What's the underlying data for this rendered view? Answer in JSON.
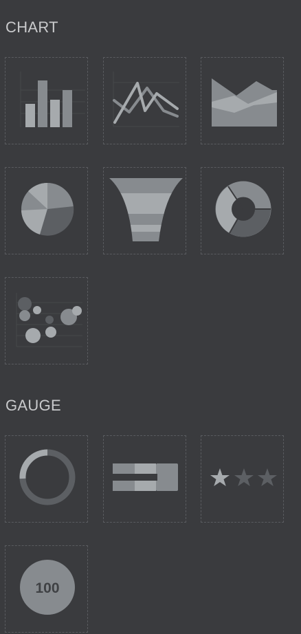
{
  "sections": {
    "chart": {
      "title": "CHART",
      "items": [
        {
          "icon": "bar-chart-icon"
        },
        {
          "icon": "line-chart-icon"
        },
        {
          "icon": "area-chart-icon"
        },
        {
          "icon": "pie-chart-icon"
        },
        {
          "icon": "funnel-chart-icon"
        },
        {
          "icon": "donut-chart-icon"
        },
        {
          "icon": "scatter-chart-icon"
        }
      ]
    },
    "gauge": {
      "title": "GAUGE",
      "items": [
        {
          "icon": "ring-gauge-icon"
        },
        {
          "icon": "bullet-gauge-icon"
        },
        {
          "icon": "star-rating-icon"
        },
        {
          "icon": "kpi-number-icon",
          "label": "100"
        }
      ]
    }
  },
  "colors": {
    "background": "#3a3b3e",
    "light": "#a6aaad",
    "mid": "#878b8f",
    "dark": "#5c5f63"
  }
}
